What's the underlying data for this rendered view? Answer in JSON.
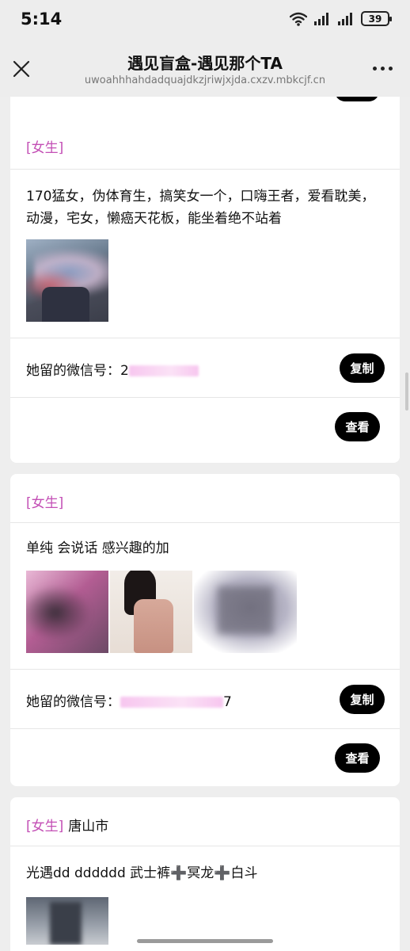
{
  "status_bar": {
    "time": "5:14",
    "battery": "39"
  },
  "nav": {
    "title": "遇见盲盒-遇见那个TA",
    "url": "uwoahhhahdadquajdkzjriwjxjda.cxzv.mbkcjf.cn"
  },
  "cards": [
    {
      "tag": "[女生]",
      "city": "",
      "description": "170猛女，伪体育生，搞笑女一个，口嗨王者，爱看耽美，动漫，宅女，懒癌天花板，能坐着绝不站着",
      "wechat_label": "她留的微信号：",
      "wechat_visible_prefix": "2",
      "wechat_visible_suffix": "",
      "copy_button": "复制",
      "view_button": "查看"
    },
    {
      "tag": "[女生]",
      "city": "",
      "description": "单纯 会说话 感兴趣的加",
      "wechat_label": "她留的微信号：",
      "wechat_visible_prefix": "",
      "wechat_visible_suffix": "7",
      "copy_button": "复制",
      "view_button": "查看"
    },
    {
      "tag": "[女生]",
      "city": "唐山市",
      "description": "光遇dd dddddd 武士裤➕冥龙➕白斗"
    }
  ]
}
